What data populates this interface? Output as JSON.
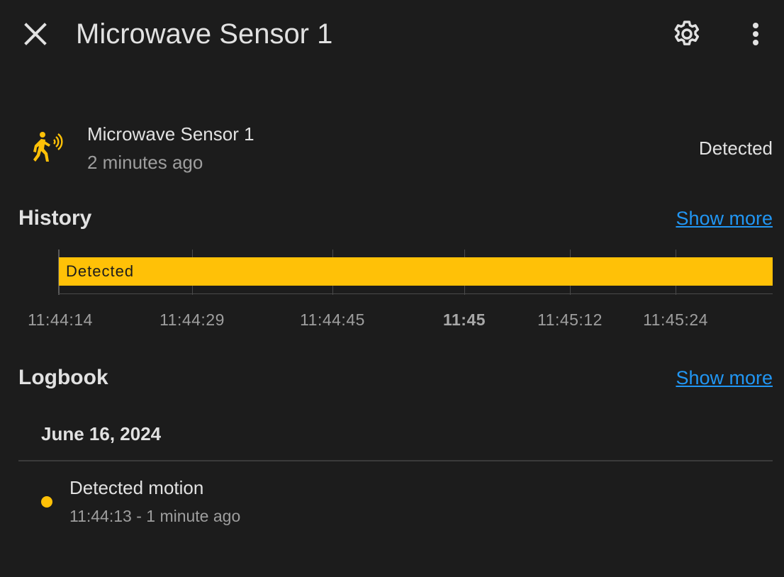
{
  "header": {
    "title": "Microwave Sensor 1",
    "close_icon": "close-icon",
    "settings_icon": "gear-icon",
    "menu_icon": "more-vertical-icon"
  },
  "entity": {
    "icon": "motion-sensor-icon",
    "name": "Microwave Sensor 1",
    "last_changed": "2 minutes ago",
    "state": "Detected"
  },
  "history": {
    "title": "History",
    "show_more": "Show more",
    "bar_label": "Detected",
    "ticks": [
      "11:44:14",
      "11:44:29",
      "11:44:45",
      "11:45",
      "11:45:12",
      "11:45:24"
    ]
  },
  "logbook": {
    "title": "Logbook",
    "show_more": "Show more",
    "date": "June 16, 2024",
    "entries": [
      {
        "message": "Detected motion",
        "time": "11:44:13 - 1 minute ago"
      }
    ]
  },
  "colors": {
    "background": "#1c1c1c",
    "accent": "#ffc107",
    "link": "#2196f3"
  }
}
